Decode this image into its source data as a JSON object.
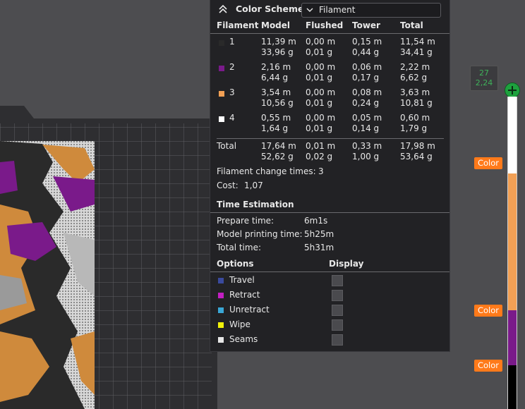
{
  "header": {
    "title": "Color Scheme",
    "scheme_value": "Filament"
  },
  "columns": [
    "Filament",
    "Model",
    "Flushed",
    "Tower",
    "Total"
  ],
  "filaments": [
    {
      "id": "1",
      "color": "#2a2a2a",
      "model": [
        "11,39 m",
        "33,96 g"
      ],
      "flushed": [
        "0,00 m",
        "0,01 g"
      ],
      "tower": [
        "0,15 m",
        "0,44 g"
      ],
      "total": [
        "11,54 m",
        "34,41 g"
      ]
    },
    {
      "id": "2",
      "color": "#7a1a8a",
      "model": [
        "2,16 m",
        "6,44 g"
      ],
      "flushed": [
        "0,00 m",
        "0,01 g"
      ],
      "tower": [
        "0,06 m",
        "0,17 g"
      ],
      "total": [
        "2,22 m",
        "6,62 g"
      ]
    },
    {
      "id": "3",
      "color": "#f2a055",
      "model": [
        "3,54 m",
        "10,56 g"
      ],
      "flushed": [
        "0,00 m",
        "0,01 g"
      ],
      "tower": [
        "0,08 m",
        "0,24 g"
      ],
      "total": [
        "3,63 m",
        "10,81 g"
      ]
    },
    {
      "id": "4",
      "color": "#ffffff",
      "model": [
        "0,55 m",
        "1,64 g"
      ],
      "flushed": [
        "0,00 m",
        "0,01 g"
      ],
      "tower": [
        "0,05 m",
        "0,14 g"
      ],
      "total": [
        "0,60 m",
        "1,79 g"
      ]
    }
  ],
  "totals": {
    "label": "Total",
    "model": [
      "17,64 m",
      "52,62 g"
    ],
    "flushed": [
      "0,01 m",
      "0,02 g"
    ],
    "tower": [
      "0,33 m",
      "1,00 g"
    ],
    "total": [
      "17,98 m",
      "53,64 g"
    ]
  },
  "filament_change": {
    "label": "Filament change times:",
    "value": "3"
  },
  "cost": {
    "label": "Cost:",
    "value": "1,07"
  },
  "time": {
    "title": "Time Estimation",
    "rows": [
      {
        "label": "Prepare time:",
        "value": "6m1s"
      },
      {
        "label": "Model printing time:",
        "value": "5h25m"
      },
      {
        "label": "Total time:",
        "value": "5h31m"
      }
    ]
  },
  "options": {
    "title": "Options",
    "display_title": "Display",
    "items": [
      {
        "label": "Travel",
        "color": "#3a4a9e"
      },
      {
        "label": "Retract",
        "color": "#c31fc3"
      },
      {
        "label": "Unretract",
        "color": "#3aa7d6"
      },
      {
        "label": "Wipe",
        "color": "#f2f20a"
      },
      {
        "label": "Seams",
        "color": "#e6e6e6"
      }
    ]
  },
  "slider": {
    "layer": "27",
    "height": "2,24",
    "color_buttons": [
      "Color",
      "Color",
      "Color"
    ],
    "segment_colors": [
      "#ffffff",
      "#f2a055",
      "#7a1a8a",
      "#000000"
    ]
  }
}
